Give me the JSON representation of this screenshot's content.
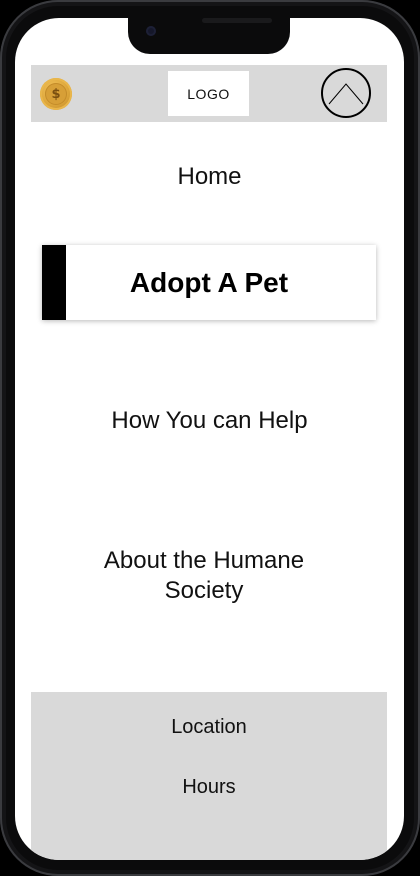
{
  "header": {
    "coin_icon": "dollar-coin-icon",
    "coin_symbol": "$",
    "logo_text": "LOGO",
    "profile_icon": "triangle-in-circle-icon"
  },
  "nav": {
    "home": "Home",
    "adopt": "Adopt A Pet",
    "help": "How You can Help",
    "about": "About the Humane Society"
  },
  "footer": {
    "location": "Location",
    "hours": "Hours"
  },
  "colors": {
    "bar_gray": "#d9d9d9",
    "active_accent": "#000000",
    "coin_gold": "#dca53a",
    "text": "#111111"
  }
}
